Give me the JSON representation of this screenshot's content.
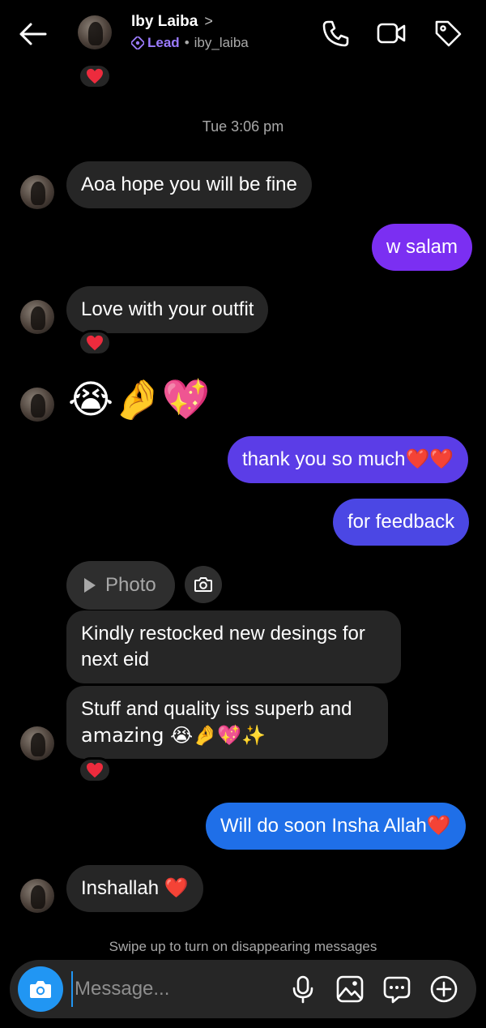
{
  "header": {
    "name": "Iby Laiba",
    "chevron": ">",
    "label": "Lead",
    "separator": "•",
    "username": "iby_laiba"
  },
  "timestamp": "Tue 3:06 pm",
  "messages": [
    {
      "text": "Aoa hope you will be fine"
    },
    {
      "text": "w salam"
    },
    {
      "text": "Love with your outfit"
    },
    {
      "text": "😭🤌💖"
    },
    {
      "text": "thank you so much❤️❤️"
    },
    {
      "text": "for feedback"
    },
    {
      "text": "Photo"
    },
    {
      "text": "Kindly restocked new desings for"
    },
    {
      "text": "next eid"
    },
    {
      "text": "Stuff and quality iss superb and"
    },
    {
      "text": "amazing 😭🤌💖✨"
    },
    {
      "text": "Will do soon Insha Allah❤️"
    },
    {
      "text": "Inshallah ❤️"
    }
  ],
  "hint": "Swipe up to turn on disappearing messages",
  "composer": {
    "placeholder": "Message..."
  },
  "colors": {
    "incoming": "#262626",
    "outgoing_top": "#7b2ff2",
    "outgoing_mid": "#5a3ee6",
    "outgoing_bottom": "#1f6fe8",
    "camera": "#2196f3",
    "heart": "#ed2b3d"
  }
}
